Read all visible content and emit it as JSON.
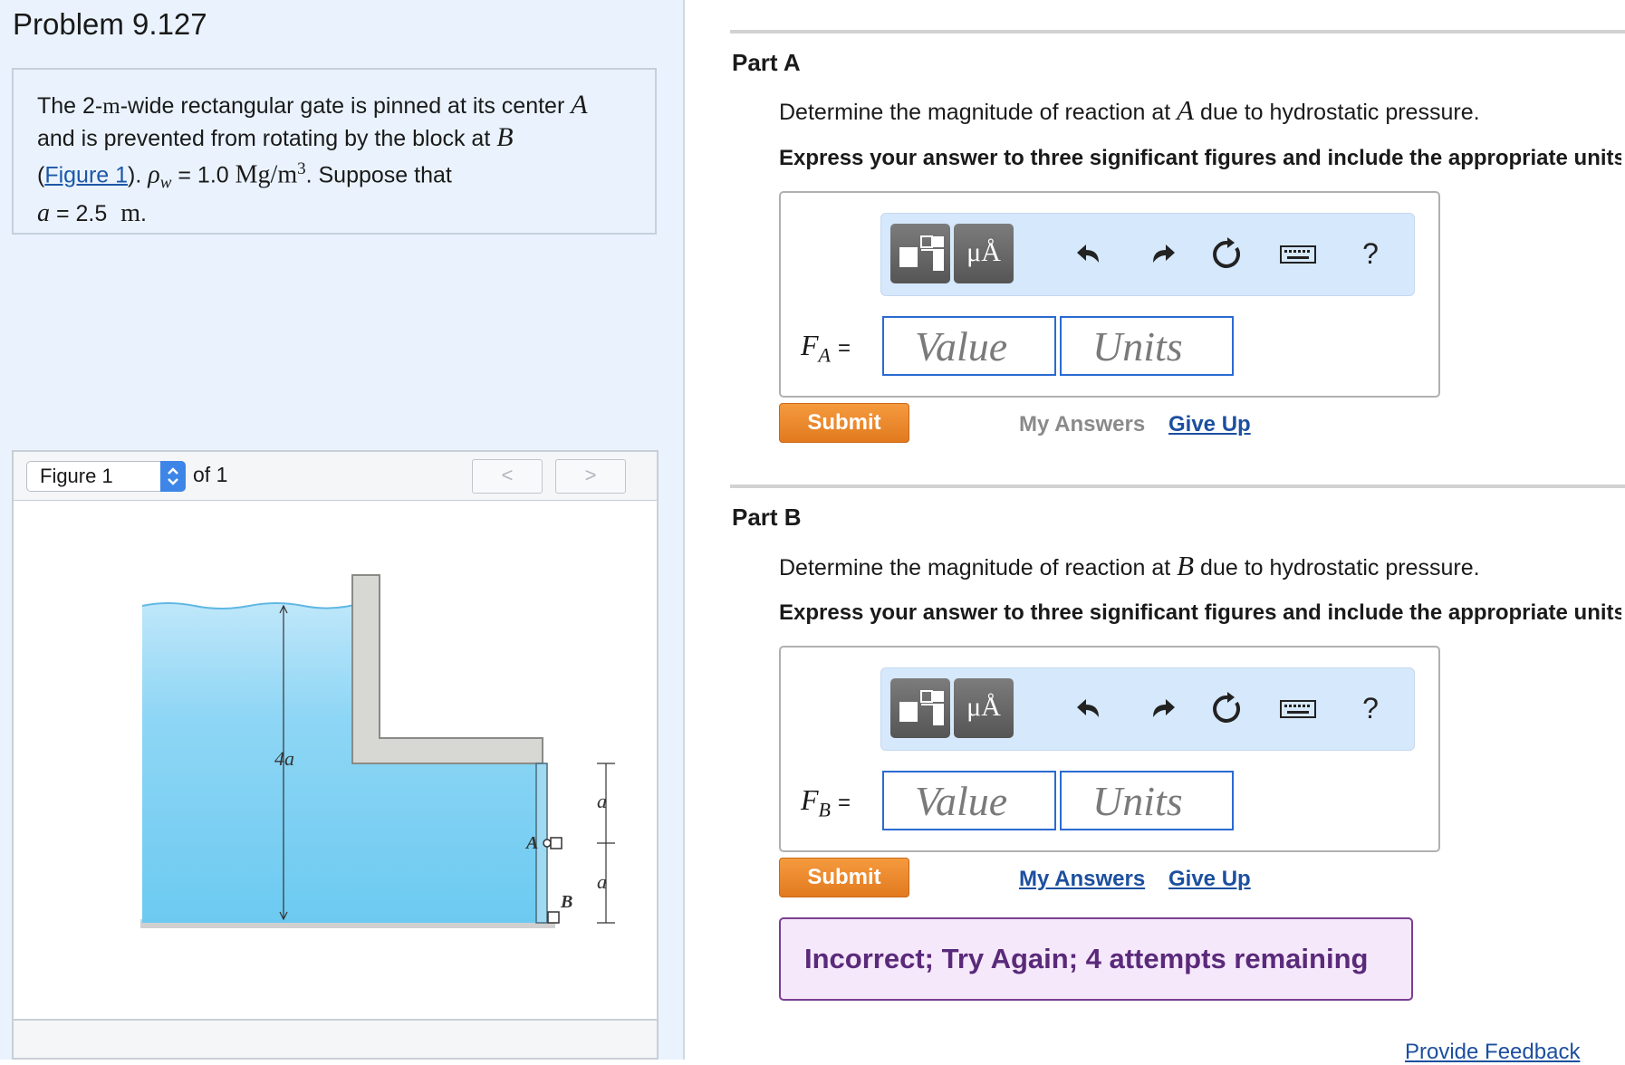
{
  "problem": {
    "title": "Problem 9.127",
    "text_1": "The 2-",
    "unit_m": "m",
    "text_2": "-wide rectangular gate is pinned at its center",
    "point_A": "A",
    "text_3": "and is prevented from rotating by the block at",
    "point_B": "B",
    "open_paren": "(",
    "figure_link": "Figure 1",
    "close_paren": ").",
    "rho_symbol": "ρ",
    "rho_sub": "w",
    "rho_eq": "= 1.0",
    "rho_unit": "Mg/m",
    "rho_exp": "3",
    "text_4": ". Suppose that",
    "a_symbol": "a",
    "a_value": "= 2.5",
    "a_unit": "m",
    "period": "."
  },
  "figure_viewer": {
    "selected": "Figure 1",
    "of_label": "of 1",
    "prev": "<",
    "next": ">",
    "labels": {
      "height": "4a",
      "a_top": "a",
      "a_bottom": "a",
      "point_A": "A",
      "point_B": "B"
    }
  },
  "parts": [
    {
      "label": "Part A",
      "question_pre": "Determine the magnitude of reaction at",
      "question_sym": "A",
      "question_post": "due to hydrostatic pressure.",
      "instruction": "Express your answer to three significant figures and include the appropriate units.",
      "var_symbol": "F",
      "var_sub": "A",
      "equals": "=",
      "value_placeholder": "Value",
      "units_placeholder": "Units",
      "units_button": "μÅ",
      "help": "?",
      "submit": "Submit",
      "my_answers": "My Answers",
      "give_up": "Give Up"
    },
    {
      "label": "Part B",
      "question_pre": "Determine the magnitude of reaction at",
      "question_sym": "B",
      "question_post": "due to hydrostatic pressure.",
      "instruction": "Express your answer to three significant figures and include the appropriate units.",
      "var_symbol": "F",
      "var_sub": "B",
      "equals": "=",
      "value_placeholder": "Value",
      "units_placeholder": "Units",
      "units_button": "μÅ",
      "help": "?",
      "submit": "Submit",
      "my_answers": "My Answers",
      "give_up": "Give Up",
      "feedback": "Incorrect; Try Again; 4 attempts remaining"
    }
  ],
  "footer": {
    "provide_feedback": "Provide Feedback"
  },
  "colors": {
    "left_bg": "#eaf3fd",
    "submit_orange": "#e8842a",
    "link_blue": "#1c4f9f",
    "input_border": "#2a6ad2",
    "water": "#74cdf2",
    "feedback_bg": "#f6e8fb",
    "feedback_text": "#5a2a7a"
  },
  "icons": [
    "templates-icon",
    "units-icon",
    "undo-icon",
    "redo-icon",
    "reset-icon",
    "keyboard-icon",
    "help-icon",
    "chevron-updown-icon"
  ]
}
